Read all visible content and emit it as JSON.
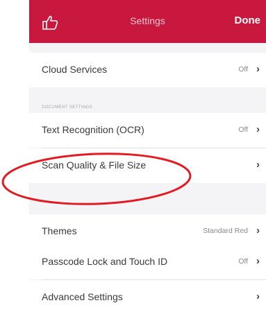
{
  "header": {
    "title": "Settings",
    "done_label": "Done",
    "icon": "thumbs-up-icon",
    "color": "#c8183e"
  },
  "rows": {
    "cloud_services": {
      "label": "Cloud Services",
      "value": "Off"
    },
    "text_recognition": {
      "label": "Text Recognition (OCR)",
      "value": "Off"
    },
    "scan_quality": {
      "label": "Scan Quality & File Size"
    },
    "themes": {
      "label": "Themes",
      "value": "Standard Red"
    },
    "passcode": {
      "label": "Passcode Lock and Touch ID",
      "value": "Off"
    },
    "advanced": {
      "label": "Advanced Settings"
    }
  },
  "sections": {
    "document_settings": "DOCUMENT SETTINGS"
  },
  "chevron": "›",
  "annotation": {
    "color": "#e21b23",
    "shape": "ellipse"
  }
}
